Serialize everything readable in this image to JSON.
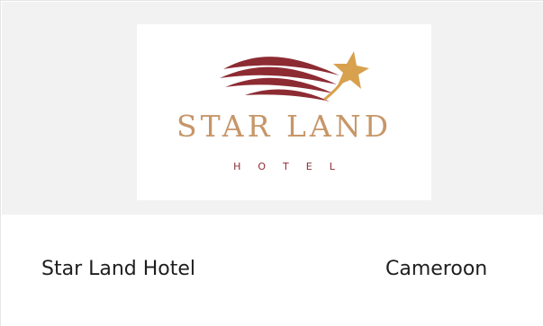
{
  "logo": {
    "name": "STAR LAND",
    "subtitle": "HOTEL",
    "icon": "shooting-star-icon",
    "colors": {
      "wave": "#8d2b33",
      "star": "#d7a14d",
      "text": "#c79669"
    }
  },
  "listing": {
    "title": "Star Land Hotel",
    "country": "Cameroon"
  }
}
